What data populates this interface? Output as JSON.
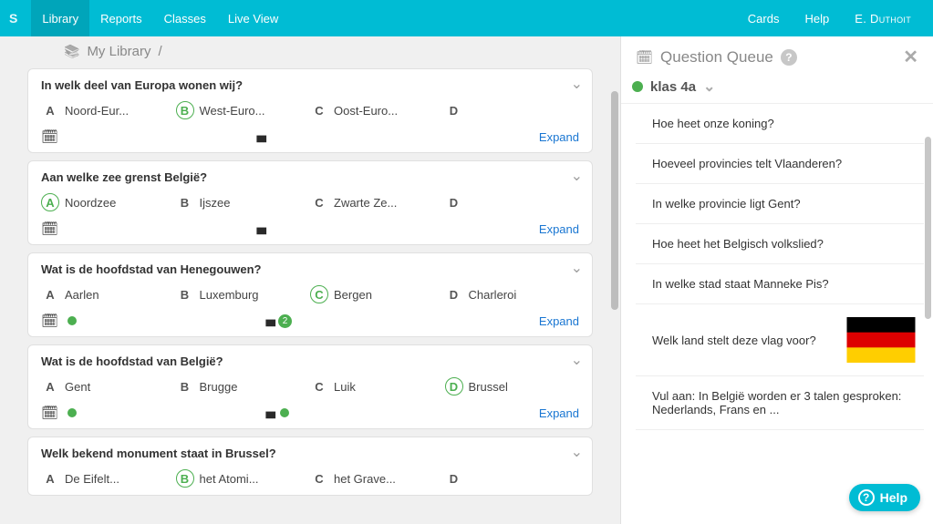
{
  "topnav": {
    "logo": "S",
    "items": [
      "Library",
      "Reports",
      "Classes",
      "Live View"
    ],
    "right": [
      "Cards",
      "Help",
      "E. Duthoit"
    ]
  },
  "breadcrumb": {
    "library_label": "My Library",
    "slash": "/"
  },
  "questions": [
    {
      "text": "In welk deel van Europa wonen wij?",
      "answers": [
        {
          "letter": "A",
          "text": "Noord-Eur...",
          "correct": false
        },
        {
          "letter": "B",
          "text": "West-Euro...",
          "correct": true
        },
        {
          "letter": "C",
          "text": "Oost-Euro...",
          "correct": false
        },
        {
          "letter": "D",
          "text": "",
          "correct": false
        }
      ],
      "has_green_cal": false,
      "has_green_chart": false,
      "chart_badge": null,
      "expand_label": "Expand"
    },
    {
      "text": "Aan welke zee grenst België?",
      "answers": [
        {
          "letter": "A",
          "text": "Noordzee",
          "correct": true
        },
        {
          "letter": "B",
          "text": "Ijszee",
          "correct": false
        },
        {
          "letter": "C",
          "text": "Zwarte Ze...",
          "correct": false
        },
        {
          "letter": "D",
          "text": "",
          "correct": false
        }
      ],
      "has_green_cal": false,
      "has_green_chart": false,
      "chart_badge": null,
      "expand_label": "Expand"
    },
    {
      "text": "Wat is de hoofdstad van Henegouwen?",
      "answers": [
        {
          "letter": "A",
          "text": "Aarlen",
          "correct": false
        },
        {
          "letter": "B",
          "text": "Luxemburg",
          "correct": false
        },
        {
          "letter": "C",
          "text": "Bergen",
          "correct": true
        },
        {
          "letter": "D",
          "text": "Charleroi",
          "correct": false
        }
      ],
      "has_green_cal": true,
      "has_green_chart": false,
      "chart_badge": "2",
      "expand_label": "Expand"
    },
    {
      "text": "Wat is de hoofdstad van België?",
      "answers": [
        {
          "letter": "A",
          "text": "Gent",
          "correct": false
        },
        {
          "letter": "B",
          "text": "Brugge",
          "correct": false
        },
        {
          "letter": "C",
          "text": "Luik",
          "correct": false
        },
        {
          "letter": "D",
          "text": "Brussel",
          "correct": true
        }
      ],
      "has_green_cal": true,
      "has_green_chart": true,
      "chart_badge": null,
      "expand_label": "Expand"
    },
    {
      "text": "Welk bekend monument staat in Brussel?",
      "answers": [
        {
          "letter": "A",
          "text": "De Eifelt...",
          "correct": false
        },
        {
          "letter": "B",
          "text": "het Atomi...",
          "correct": true
        },
        {
          "letter": "C",
          "text": "het Grave...",
          "correct": false
        },
        {
          "letter": "D",
          "text": "",
          "correct": false
        }
      ],
      "has_green_cal": false,
      "has_green_chart": false,
      "chart_badge": null,
      "expand_label": "Expand"
    }
  ],
  "queue": {
    "title": "Question Queue",
    "class_name": "klas 4a",
    "items": [
      {
        "text": "Hoe heet onze koning?"
      },
      {
        "text": "Hoeveel provincies telt Vlaanderen?"
      },
      {
        "text": "In welke provincie ligt Gent?"
      },
      {
        "text": "Hoe heet het Belgisch volkslied?"
      },
      {
        "text": "In welke stad staat Manneke Pis?"
      },
      {
        "text": "Welk land stelt deze vlag voor?",
        "flag": "germany"
      },
      {
        "text": "Vul aan: In België worden er 3 talen gesproken: Nederlands, Frans en ..."
      }
    ]
  },
  "help_pill": "Help"
}
